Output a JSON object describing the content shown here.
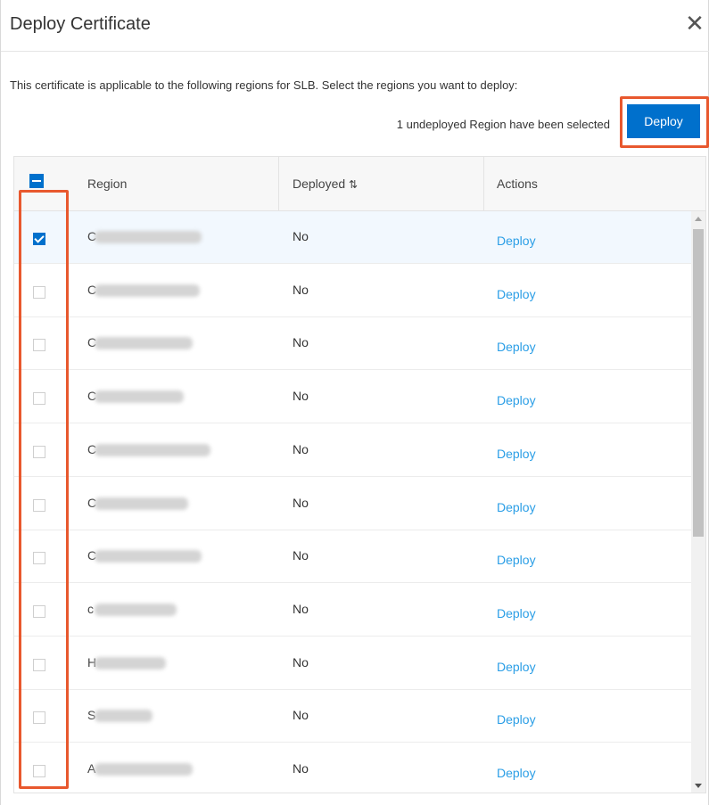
{
  "dialog": {
    "title": "Deploy Certificate",
    "close_icon": "close-icon",
    "description": "This certificate is applicable to the following regions for SLB. Select the regions you want to deploy:",
    "selection_info": "1 undeployed Region have been selected",
    "deploy_button": "Deploy"
  },
  "table": {
    "columns": [
      "Region",
      "Deployed",
      "Actions"
    ],
    "sort_icon": "sort-icon",
    "rows": [
      {
        "region_initial": "C",
        "deployed": "No",
        "action": "Deploy",
        "checked": true
      },
      {
        "region_initial": "C",
        "deployed": "No",
        "action": "Deploy",
        "checked": false
      },
      {
        "region_initial": "C",
        "deployed": "No",
        "action": "Deploy",
        "checked": false
      },
      {
        "region_initial": "C",
        "deployed": "No",
        "action": "Deploy",
        "checked": false
      },
      {
        "region_initial": "C",
        "deployed": "No",
        "action": "Deploy",
        "checked": false
      },
      {
        "region_initial": "C",
        "deployed": "No",
        "action": "Deploy",
        "checked": false
      },
      {
        "region_initial": "C",
        "deployed": "No",
        "action": "Deploy",
        "checked": false
      },
      {
        "region_initial": "c",
        "deployed": "No",
        "action": "Deploy",
        "checked": false
      },
      {
        "region_initial": "H",
        "deployed": "No",
        "action": "Deploy",
        "checked": false
      },
      {
        "region_initial": "S",
        "deployed": "No",
        "action": "Deploy",
        "checked": false
      },
      {
        "region_initial": "A",
        "deployed": "No",
        "action": "Deploy",
        "checked": false
      }
    ]
  },
  "colors": {
    "primary": "#0070cc",
    "link": "#2a9ee6",
    "highlight": "#e8582e"
  }
}
